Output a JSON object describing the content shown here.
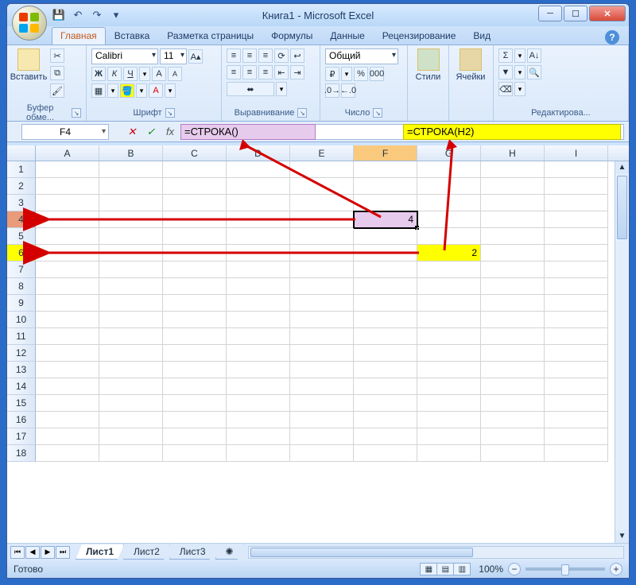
{
  "title": "Книга1 - Microsoft Excel",
  "qat": {
    "save": "💾",
    "undo": "↶",
    "redo": "↷"
  },
  "tabs": [
    "Главная",
    "Вставка",
    "Разметка страницы",
    "Формулы",
    "Данные",
    "Рецензирование",
    "Вид"
  ],
  "activeTab": "Главная",
  "ribbon": {
    "clipboard": {
      "label": "Буфер обме...",
      "paste": "Вставить"
    },
    "font": {
      "label": "Шрифт",
      "name": "Calibri",
      "size": "11",
      "bold": "Ж",
      "italic": "К",
      "underline": "Ч"
    },
    "align": {
      "label": "Выравнивание"
    },
    "number": {
      "label": "Число",
      "format": "Общий"
    },
    "styles": {
      "label": "Стили"
    },
    "cells": {
      "label": "Ячейки"
    },
    "editing": {
      "label": "Редактирова..."
    }
  },
  "namebox": "F4",
  "formula": "=СТРОКА()",
  "annot": {
    "pink": "=СТРОКА()",
    "yellow": "=СТРОКА(H2)"
  },
  "columns": [
    "A",
    "B",
    "C",
    "D",
    "E",
    "F",
    "G",
    "H",
    "I"
  ],
  "rows": [
    "1",
    "2",
    "3",
    "4",
    "5",
    "6",
    "7",
    "8",
    "9",
    "10",
    "11",
    "12",
    "13",
    "14",
    "15",
    "16",
    "17",
    "18"
  ],
  "cells": {
    "F4": "4",
    "G6": "2"
  },
  "sheets": [
    "Лист1",
    "Лист2",
    "Лист3"
  ],
  "activeSheet": "Лист1",
  "status": "Готово",
  "zoom": "100%"
}
